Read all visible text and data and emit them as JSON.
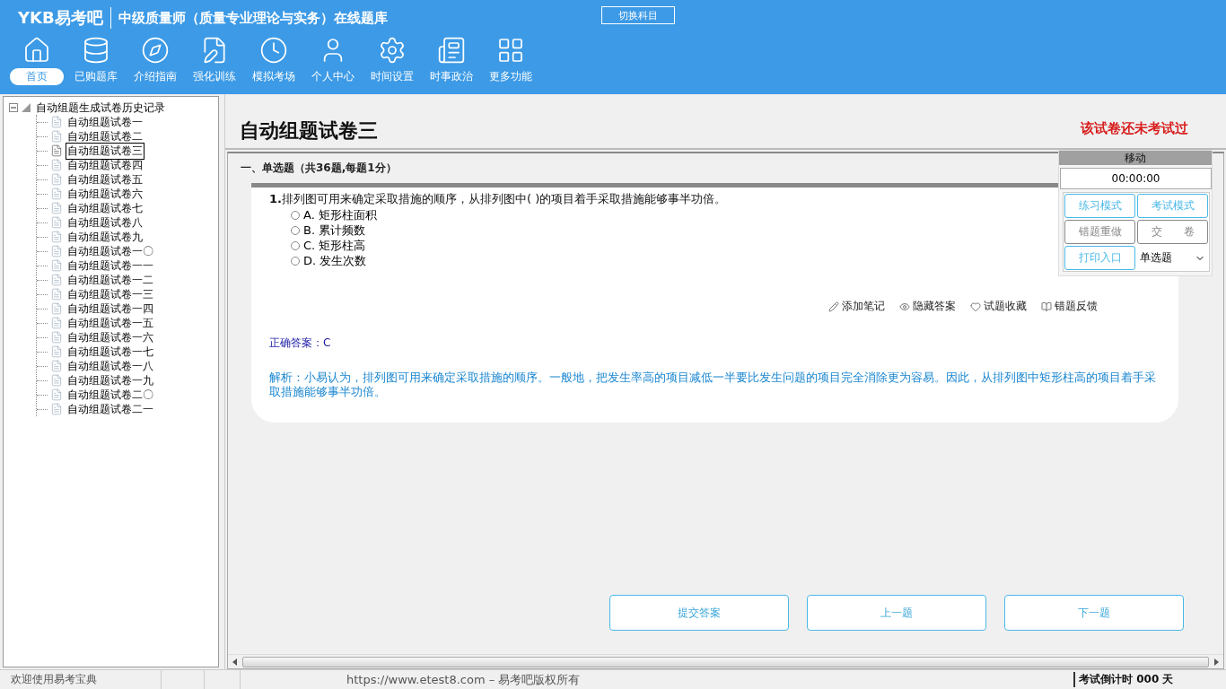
{
  "app": {
    "logo": "YKB易考吧",
    "title": "中级质量师（质量专业理论与实务）在线题库",
    "switch_button": "切换科目"
  },
  "nav": [
    {
      "label": "首页",
      "selected": true
    },
    {
      "label": "已购题库",
      "selected": false
    },
    {
      "label": "介绍指南",
      "selected": false
    },
    {
      "label": "强化训练",
      "selected": false
    },
    {
      "label": "模拟考场",
      "selected": false
    },
    {
      "label": "个人中心",
      "selected": false
    },
    {
      "label": "时间设置",
      "selected": false
    },
    {
      "label": "时事政治",
      "selected": false
    },
    {
      "label": "更多功能",
      "selected": false
    }
  ],
  "tree": {
    "label": "自动组题生成试卷历史记录",
    "expanded": true,
    "children": [
      {
        "label": "自动组题试卷一",
        "selected": false
      },
      {
        "label": "自动组题试卷二",
        "selected": false
      },
      {
        "label": "自动组题试卷三",
        "selected": true
      },
      {
        "label": "自动组题试卷四",
        "selected": false
      },
      {
        "label": "自动组题试卷五",
        "selected": false
      },
      {
        "label": "自动组题试卷六",
        "selected": false
      },
      {
        "label": "自动组题试卷七",
        "selected": false
      },
      {
        "label": "自动组题试卷八",
        "selected": false
      },
      {
        "label": "自动组题试卷九",
        "selected": false
      },
      {
        "label": "自动组题试卷一〇",
        "selected": false
      },
      {
        "label": "自动组题试卷一一",
        "selected": false
      },
      {
        "label": "自动组题试卷一二",
        "selected": false
      },
      {
        "label": "自动组题试卷一三",
        "selected": false
      },
      {
        "label": "自动组题试卷一四",
        "selected": false
      },
      {
        "label": "自动组题试卷一五",
        "selected": false
      },
      {
        "label": "自动组题试卷一六",
        "selected": false
      },
      {
        "label": "自动组题试卷一七",
        "selected": false
      },
      {
        "label": "自动组题试卷一八",
        "selected": false
      },
      {
        "label": "自动组题试卷一九",
        "selected": false
      },
      {
        "label": "自动组题试卷二〇",
        "selected": false
      },
      {
        "label": "自动组题试卷二一",
        "selected": false
      }
    ]
  },
  "paper": {
    "title": "自动组题试卷三",
    "status": "该试卷还未考试过",
    "section": "一、单选题（共36题,每题1分）",
    "question": {
      "number": "1.",
      "text": "排列图可用来确定采取措施的顺序，从排列图中( )的项目着手采取措施能够事半功倍。",
      "options": [
        {
          "label": "A. 矩形柱面积",
          "selected": false
        },
        {
          "label": "B. 累计频数",
          "selected": false
        },
        {
          "label": "C. 矩形柱高",
          "selected": false
        },
        {
          "label": "D. 发生次数",
          "selected": false
        }
      ],
      "actions": [
        "添加笔记",
        "隐藏答案",
        "试题收藏",
        "错题反馈"
      ],
      "answer": "正确答案：C",
      "explanation": "解析：小易认为，排列图可用来确定采取措施的顺序。一般地，把发生率高的项目减低一半要比发生问题的项目完全消除更为容易。因此，从排列图中矩形柱高的项目着手采取措施能够事半功倍。"
    },
    "buttons": [
      "提交答案",
      "上一题",
      "下一题"
    ]
  },
  "tool_panel": {
    "title": "移动",
    "timer": "00:00:00",
    "buttons": [
      {
        "label": "练习模式",
        "disabled": false
      },
      {
        "label": "考试模式",
        "disabled": false
      },
      {
        "label": "错题重做",
        "disabled": true
      },
      {
        "label": "交　　卷",
        "disabled": true
      },
      {
        "label": "打印入口",
        "disabled": false
      }
    ],
    "type_select": "单选题"
  },
  "status_bar": {
    "welcome": "欢迎使用易考宝典",
    "copyright": "https://www.etest8.com – 易考吧版权所有",
    "countdown": "考试倒计时 000 天"
  }
}
